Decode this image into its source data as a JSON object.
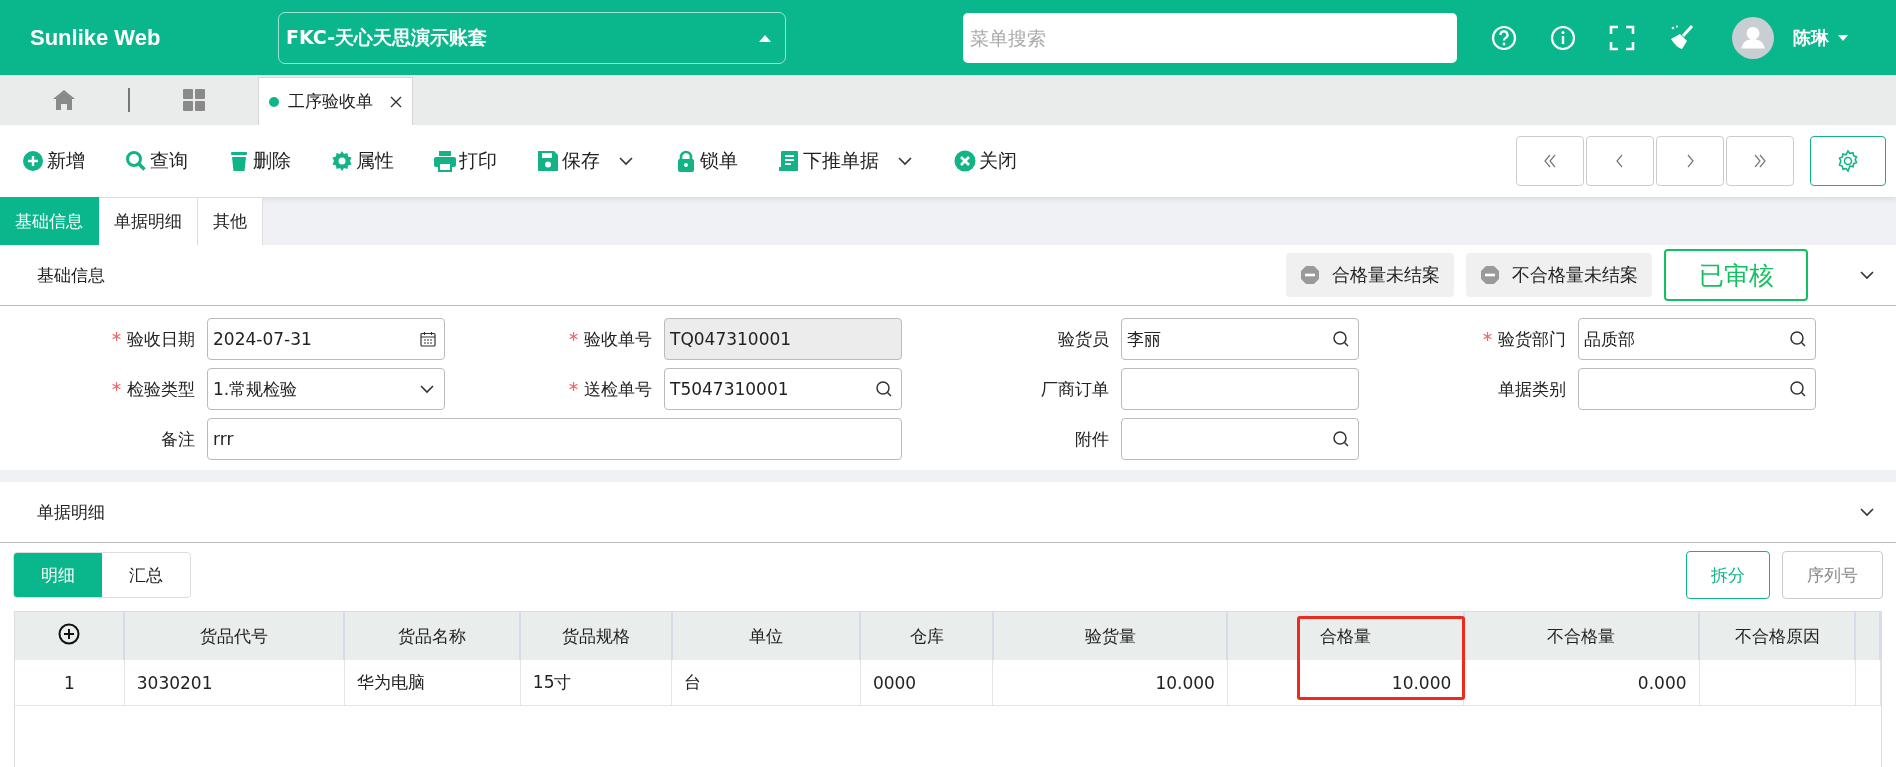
{
  "header": {
    "logo": "Sunlike Web",
    "account": "FKC-天心天思演示账套",
    "search": {
      "placeholder": "菜单搜索"
    },
    "user": "陈琳"
  },
  "page_tabs": [
    {
      "label": "工序验收单",
      "selected": true
    }
  ],
  "toolbar": [
    {
      "label": "新增",
      "kind": "plus",
      "dropdown": false
    },
    {
      "label": "查询",
      "kind": "search",
      "dropdown": false
    },
    {
      "label": "删除",
      "kind": "trash",
      "dropdown": false
    },
    {
      "label": "属性",
      "kind": "gear",
      "dropdown": false
    },
    {
      "label": "打印",
      "kind": "printer",
      "dropdown": false
    },
    {
      "label": "保存",
      "kind": "save",
      "dropdown": true
    },
    {
      "label": "锁单",
      "kind": "lock",
      "dropdown": false
    },
    {
      "label": "下推单据",
      "kind": "document",
      "dropdown": true
    },
    {
      "label": "关闭",
      "kind": "close",
      "dropdown": false
    }
  ],
  "form_tabs": [
    {
      "label": "基础信息",
      "selected": true
    },
    {
      "label": "单据明细",
      "selected": false
    },
    {
      "label": "其他",
      "selected": false
    }
  ],
  "basic_info": {
    "title": "基础信息",
    "expanded": true,
    "status_chips": [
      "合格量未结案",
      "不合格量未结案"
    ],
    "stamp": "已审核",
    "fields": [
      {
        "label": "验收日期",
        "required": true,
        "kind": "date",
        "value": "2024-07-31"
      },
      {
        "label": "验收单号",
        "required": true,
        "kind": "readonly",
        "value": "TQ047310001"
      },
      {
        "label": "验货员",
        "required": false,
        "kind": "lookup",
        "value": "李丽"
      },
      {
        "label": "验货部门",
        "required": true,
        "kind": "lookup",
        "value": "品质部"
      },
      {
        "label": "检验类型",
        "required": true,
        "kind": "select",
        "value": "1.常规检验"
      },
      {
        "label": "送检单号",
        "required": true,
        "kind": "lookup",
        "value": "T5047310001"
      },
      {
        "label": "厂商订单",
        "required": false,
        "kind": "text"
      },
      {
        "label": "单据类别",
        "required": false,
        "kind": "lookup"
      },
      {
        "label": "备注",
        "required": false,
        "kind": "text",
        "value": "rrr",
        "wide": true
      },
      {
        "label": "附件",
        "required": false,
        "kind": "lookup"
      }
    ]
  },
  "detail": {
    "title": "单据明细",
    "expanded": true,
    "tabs": [
      {
        "label": "明细",
        "selected": true
      },
      {
        "label": "汇总",
        "selected": false
      }
    ],
    "buttons": [
      {
        "label": "拆分",
        "disabled": false
      },
      {
        "label": "序列号",
        "disabled": true
      }
    ],
    "table": {
      "columns": [
        {
          "label": "货品代号",
          "kind": "text",
          "highlighted": false
        },
        {
          "label": "货品名称",
          "kind": "text",
          "highlighted": false
        },
        {
          "label": "货品规格",
          "kind": "text",
          "highlighted": false
        },
        {
          "label": "单位",
          "kind": "text",
          "highlighted": false
        },
        {
          "label": "仓库",
          "kind": "text",
          "highlighted": false
        },
        {
          "label": "验货量",
          "kind": "number",
          "highlighted": false
        },
        {
          "label": "合格量",
          "kind": "number",
          "highlighted": true
        },
        {
          "label": "不合格量",
          "kind": "number",
          "highlighted": false
        },
        {
          "label": "不合格原因",
          "kind": "text",
          "highlighted": false
        }
      ],
      "rows": [
        {
          "number": "1",
          "cells": [
            "3030201",
            "华为电脑",
            "15寸",
            "台",
            "0000",
            "10.000",
            "10.000",
            "0.000",
            ""
          ]
        }
      ]
    }
  }
}
